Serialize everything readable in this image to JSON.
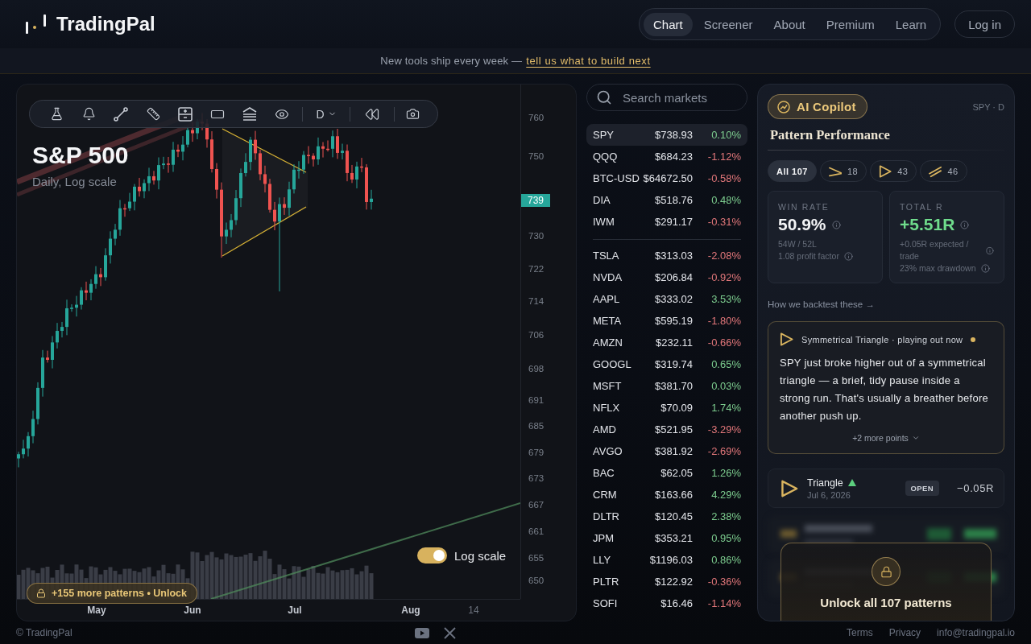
{
  "header": {
    "logo": "TradingPal",
    "nav": [
      {
        "label": "Chart",
        "selected": true
      },
      {
        "label": "Screener",
        "selected": false
      },
      {
        "label": "About",
        "selected": false
      },
      {
        "label": "Premium",
        "selected": false
      },
      {
        "label": "Learn",
        "selected": false
      }
    ],
    "login": "Log in"
  },
  "banner": {
    "text": "New tools ship every week —",
    "link": "tell us what to build next"
  },
  "chart": {
    "title": "S&P 500",
    "subtitle": "Daily, Log scale",
    "toolbar": {
      "timeframe": "D"
    },
    "price_axis": [
      "760",
      "750",
      "730",
      "722",
      "714",
      "706",
      "698",
      "691",
      "685",
      "679",
      "673",
      "667",
      "661",
      "655",
      "650"
    ],
    "current_price": "739",
    "time_axis": [
      {
        "label": "May",
        "kind": "month"
      },
      {
        "label": "Jun",
        "kind": "month"
      },
      {
        "label": "Jul",
        "kind": "month"
      },
      {
        "label": "Aug",
        "kind": "month"
      },
      {
        "label": "14",
        "kind": "day"
      }
    ],
    "log_toggle": {
      "label": "Log scale",
      "on": true
    },
    "unlock": "+155 more patterns • Unlock"
  },
  "watchlist": {
    "search": {
      "placeholder": "Search markets"
    },
    "groups": [
      {
        "rows": [
          {
            "symbol": "SPY",
            "price": "$738.93",
            "change": "0.10%",
            "color": "#7dcd8f",
            "selected": true
          },
          {
            "symbol": "QQQ",
            "price": "$684.23",
            "change": "-1.12%",
            "color": "#e2777a",
            "selected": false
          },
          {
            "symbol": "BTC-USD",
            "price": "$64672.50",
            "change": "-0.58%",
            "color": "#e2777a",
            "selected": false
          },
          {
            "symbol": "DIA",
            "price": "$518.76",
            "change": "0.48%",
            "color": "#7dcd8f",
            "selected": false
          },
          {
            "symbol": "IWM",
            "price": "$291.17",
            "change": "-0.31%",
            "color": "#e2777a",
            "selected": false
          }
        ]
      },
      {
        "rows": [
          {
            "symbol": "TSLA",
            "price": "$313.03",
            "change": "-2.08%",
            "color": "#e2777a",
            "selected": false
          },
          {
            "symbol": "NVDA",
            "price": "$206.84",
            "change": "-0.92%",
            "color": "#e2777a",
            "selected": false
          },
          {
            "symbol": "AAPL",
            "price": "$333.02",
            "change": "3.53%",
            "color": "#7dcd8f",
            "selected": false
          },
          {
            "symbol": "META",
            "price": "$595.19",
            "change": "-1.80%",
            "color": "#e2777a",
            "selected": false
          },
          {
            "symbol": "AMZN",
            "price": "$232.11",
            "change": "-0.66%",
            "color": "#e2777a",
            "selected": false
          },
          {
            "symbol": "GOOGL",
            "price": "$319.74",
            "change": "0.65%",
            "color": "#7dcd8f",
            "selected": false
          },
          {
            "symbol": "MSFT",
            "price": "$381.70",
            "change": "0.03%",
            "color": "#7dcd8f",
            "selected": false
          },
          {
            "symbol": "NFLX",
            "price": "$70.09",
            "change": "1.74%",
            "color": "#7dcd8f",
            "selected": false
          },
          {
            "symbol": "AMD",
            "price": "$521.95",
            "change": "-3.29%",
            "color": "#e2777a",
            "selected": false
          },
          {
            "symbol": "AVGO",
            "price": "$381.92",
            "change": "-2.69%",
            "color": "#e2777a",
            "selected": false
          },
          {
            "symbol": "BAC",
            "price": "$62.05",
            "change": "1.26%",
            "color": "#7dcd8f",
            "selected": false
          },
          {
            "symbol": "CRM",
            "price": "$163.66",
            "change": "4.29%",
            "color": "#7dcd8f",
            "selected": false
          },
          {
            "symbol": "DLTR",
            "price": "$120.45",
            "change": "2.38%",
            "color": "#7dcd8f",
            "selected": false
          },
          {
            "symbol": "JPM",
            "price": "$353.21",
            "change": "0.95%",
            "color": "#7dcd8f",
            "selected": false
          },
          {
            "symbol": "LLY",
            "price": "$1196.03",
            "change": "0.86%",
            "color": "#7dcd8f",
            "selected": false
          },
          {
            "symbol": "PLTR",
            "price": "$122.92",
            "change": "-0.36%",
            "color": "#e2777a",
            "selected": false
          },
          {
            "symbol": "SOFI",
            "price": "$16.46",
            "change": "-1.14%",
            "color": "#e2777a",
            "selected": false
          }
        ]
      }
    ]
  },
  "copilot": {
    "badge": "AI Copilot",
    "context": "SPY · D",
    "heading": "Pattern Performance",
    "filters": [
      {
        "kind": "all",
        "label": "All 107",
        "selected": true
      },
      {
        "kind": "falling",
        "label": "18",
        "selected": false
      },
      {
        "kind": "triangle",
        "label": "43",
        "selected": false
      },
      {
        "kind": "rising",
        "label": "46",
        "selected": false
      }
    ],
    "stats": [
      {
        "label": "WIN RATE",
        "value": "50.9%",
        "color": "#f3f4f6",
        "lines": [
          {
            "text": "54W / 52L",
            "info": false
          },
          {
            "text": "1.08 profit factor",
            "info": true
          }
        ]
      },
      {
        "label": "TOTAL R",
        "value": "+5.51R",
        "color": "#6fdc8c",
        "lines": [
          {
            "text": "+0.05R expected / trade",
            "info": true
          },
          {
            "text": "23% max drawdown",
            "info": true
          }
        ]
      }
    ],
    "method_link": "How we backtest these →",
    "insight": {
      "title": "Symmetrical Triangle · playing out now",
      "live": true,
      "body": "SPY just broke higher out of a symmetrical triangle — a brief, tidy pause inside a strong run. That's usually a breather before another push up.",
      "more": "+2 more points"
    },
    "trades": [
      {
        "name": "Triangle",
        "bullish": true,
        "date": "Jul 6, 2026",
        "status": "OPEN",
        "result": "−0.05R"
      }
    ],
    "locked": {
      "title": "Unlock all 107 patterns"
    }
  },
  "footer": {
    "copyright": "© TradingPal",
    "links": [
      "Terms",
      "Privacy",
      "info@tradingpal.io"
    ]
  }
}
